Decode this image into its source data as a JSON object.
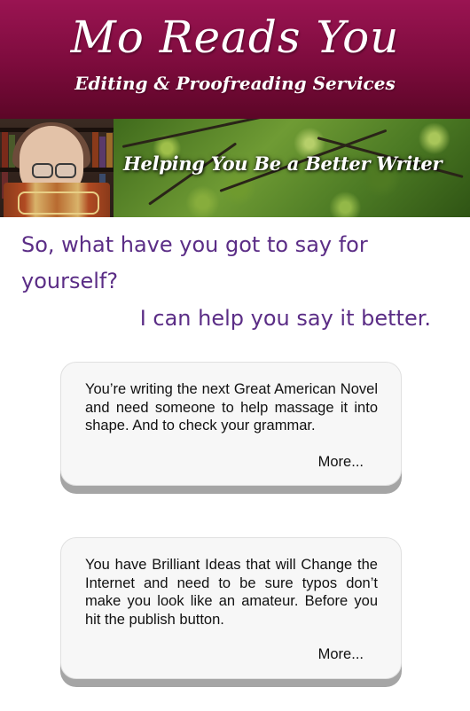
{
  "header": {
    "title": "Mo Reads You",
    "tagline": "Editing & Proofreading Services",
    "background_color": "#7c0b3c"
  },
  "banner": {
    "caption": "Helping You Be a Better Writer"
  },
  "intro": {
    "question": "So, what have you got to say for yourself?",
    "answer": "I can help you say it better.",
    "text_color": "#5b2d86"
  },
  "cards": [
    {
      "text": "You’re writing the next Great American Novel and need someone to help massage it into shape. And to check your grammar.",
      "more_label": "More..."
    },
    {
      "text": "You have Brilliant Ideas that will Change the Internet and need to be sure typos don’t make you look like an amateur. Before you hit the publish button.",
      "more_label": "More..."
    }
  ]
}
